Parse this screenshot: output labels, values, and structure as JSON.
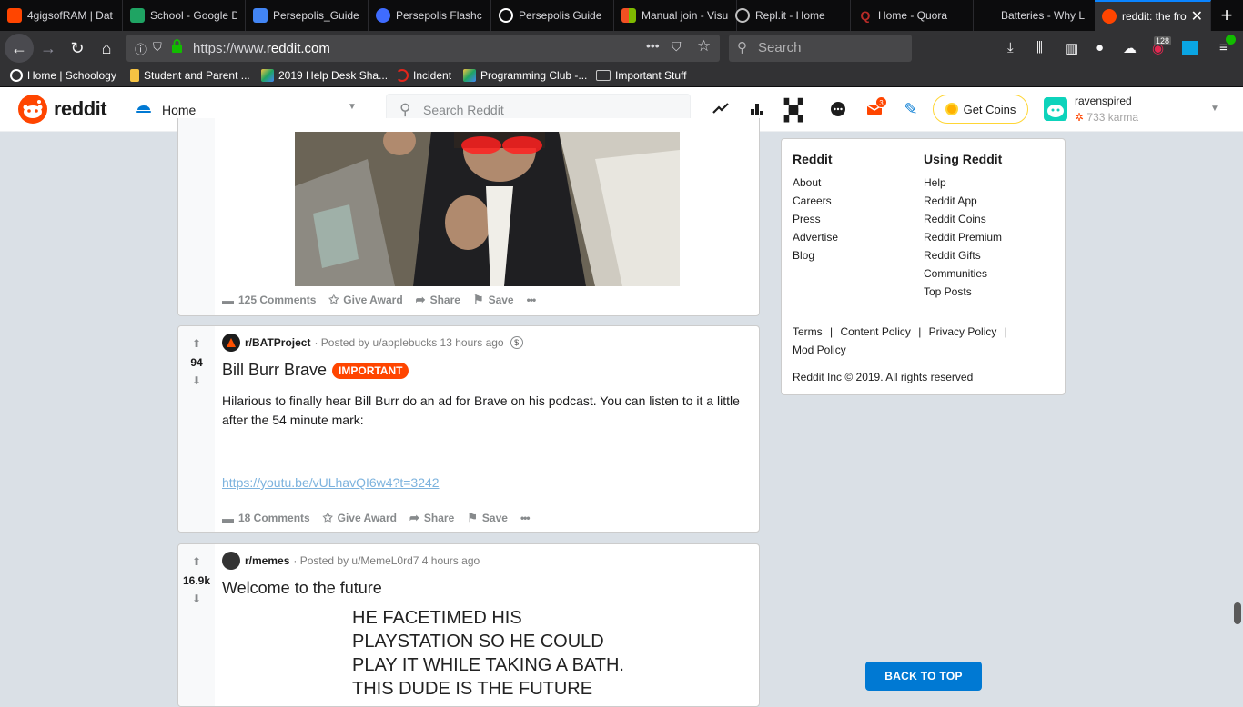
{
  "browser": {
    "tabs": [
      {
        "title": "4gigsofRAM | Dat",
        "icon_color": "#ff4500"
      },
      {
        "title": "School - Google D",
        "icon_color": "#1fa463"
      },
      {
        "title": "Persepolis_Guide",
        "icon_color": "#4285f4"
      },
      {
        "title": "Persepolis Flashc",
        "icon_color": "#3f6cff"
      },
      {
        "title": "Persepolis Guide",
        "icon_color": "#ffffff"
      },
      {
        "title": "Manual join - Visu",
        "icon_color": "#f25022"
      },
      {
        "title": "Repl.it - Home",
        "icon_color": "#c0c0c0"
      },
      {
        "title": "Home - Quora",
        "icon_color": "#b92b27"
      },
      {
        "title": "Batteries - Why L",
        "icon_color": "#a2aaad"
      },
      {
        "title": "reddit: the front",
        "icon_color": "#ff4500"
      }
    ],
    "url_prefix": "https://www.",
    "url_domain": "reddit.com",
    "search_placeholder": "Search",
    "badge_count": "128",
    "bookmarks": [
      {
        "label": "Home | Schoology",
        "color": "#0677ba"
      },
      {
        "label": "Student and Parent ...",
        "color": "#f6c343"
      },
      {
        "label": "2019 Help Desk Sha...",
        "color": "#1fa463"
      },
      {
        "label": "Incident",
        "color": "#e2251b"
      },
      {
        "label": "Programming Club -...",
        "color": "#1fa463"
      },
      {
        "label": "Important Stuff",
        "color": "#c8c8c8"
      }
    ]
  },
  "header": {
    "logo_text": "reddit",
    "feed_label": "Home",
    "search_placeholder": "Search Reddit",
    "mail_badge": "3",
    "get_coins_label": "Get Coins",
    "username": "ravenspired",
    "karma": "733 karma"
  },
  "posts": [
    {
      "actions": {
        "comments": "125 Comments",
        "award": "Give Award",
        "share": "Share",
        "save": "Save",
        "more": "•••"
      }
    },
    {
      "subreddit": "r/BATProject",
      "posted_by": "· Posted by u/applebucks 13 hours ago",
      "votes": "94",
      "title": "Bill Burr Brave",
      "flair": "IMPORTANT",
      "body": "Hilarious to finally hear Bill Burr do an ad for Brave on his podcast. You can listen to it a little after the 54 minute mark:",
      "link": "https://youtu.be/vULhavQI6w4?t=3242",
      "actions": {
        "comments": "18 Comments",
        "award": "Give Award",
        "share": "Share",
        "save": "Save",
        "more": "•••"
      }
    },
    {
      "subreddit": "r/memes",
      "posted_by": "· Posted by u/MemeL0rd7 4 hours ago",
      "votes": "16.9k",
      "title": "Welcome to the future",
      "meme_lines": [
        "HE FACETIMED HIS",
        "PLAYSTATION SO HE COULD",
        "PLAY IT WHILE TAKING A BATH.",
        "THIS DUDE IS THE FUTURE"
      ]
    }
  ],
  "sidebar": {
    "col1_title": "Reddit",
    "col1": [
      "About",
      "Careers",
      "Press",
      "Advertise",
      "Blog"
    ],
    "col2_title": "Using Reddit",
    "col2": [
      "Help",
      "Reddit App",
      "Reddit Coins",
      "Reddit Premium",
      "Reddit Gifts",
      "Communities",
      "Top Posts"
    ],
    "terms": "Terms",
    "content_policy": "Content Policy",
    "privacy_policy": "Privacy Policy",
    "mod_policy": "Mod Policy",
    "sep": "|",
    "copyright": "Reddit Inc © 2019. All rights reserved"
  },
  "back_to_top": "BACK TO TOP"
}
